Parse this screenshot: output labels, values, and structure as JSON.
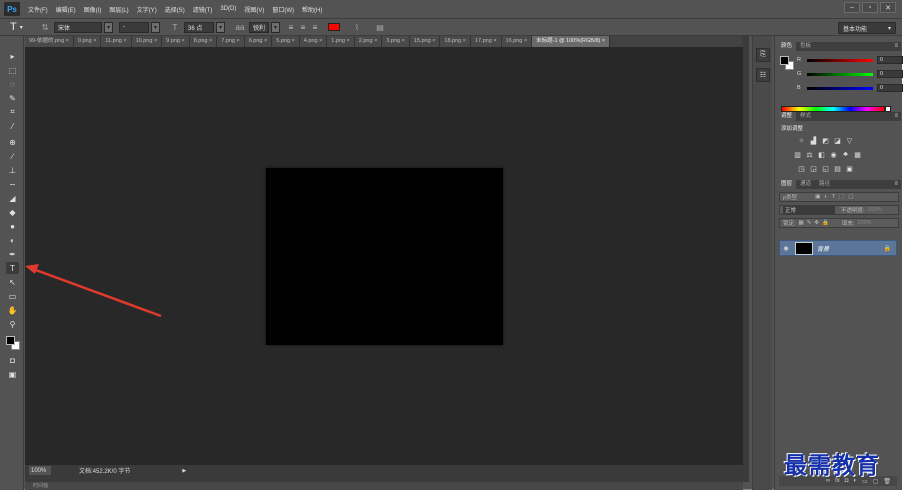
{
  "app": {
    "logo": "Ps"
  },
  "menu": [
    "文件(F)",
    "编辑(E)",
    "图像(I)",
    "图层(L)",
    "文字(Y)",
    "选择(S)",
    "滤镜(T)",
    "3D(D)",
    "视图(V)",
    "窗口(W)",
    "帮助(H)"
  ],
  "window_controls": {
    "minimize": "–",
    "restore": "▫",
    "close": "✕"
  },
  "options": {
    "tool_glyph": "T",
    "font_family": "宋体",
    "font_style": "-",
    "font_size": "36 点",
    "aa_label": "aa",
    "antialias": "锐利",
    "text_color": "#ff0000",
    "workspace": "基本功能"
  },
  "tabs": [
    {
      "label": "99-依据的.png"
    },
    {
      "label": "0.png"
    },
    {
      "label": "11.png"
    },
    {
      "label": "10.png"
    },
    {
      "label": "9.png"
    },
    {
      "label": "8.png"
    },
    {
      "label": "7.png"
    },
    {
      "label": "6.png"
    },
    {
      "label": "5.png"
    },
    {
      "label": "4.png"
    },
    {
      "label": "1.png"
    },
    {
      "label": "2.png"
    },
    {
      "label": "3.png"
    },
    {
      "label": "15.png"
    },
    {
      "label": "18.png"
    },
    {
      "label": "17.png"
    },
    {
      "label": "16.png"
    },
    {
      "label": "未标题-1 @ 100%(RGB/8)",
      "active": true
    }
  ],
  "status": {
    "zoom": "100%",
    "doc": "文档:452.2K/0 字节",
    "arrow": "▶"
  },
  "timeline": {
    "label": "时间轴"
  },
  "color_panel": {
    "tabs": [
      "颜色",
      "色板"
    ],
    "channels": [
      {
        "label": "R",
        "value": "0"
      },
      {
        "label": "G",
        "value": "0"
      },
      {
        "label": "B",
        "value": "0"
      }
    ]
  },
  "adjust_panel": {
    "tabs": [
      "调整",
      "样式"
    ],
    "title": "添加调整"
  },
  "layers_panel": {
    "tabs": [
      "图层",
      "通道",
      "路径"
    ],
    "filter": "ρ类型",
    "blend": "正常",
    "opacity_label": "不透明度:",
    "opacity_value": "100%",
    "lock_label": "锁定:",
    "fill_label": "填充:",
    "fill_value": "100%",
    "layer_name": "背景"
  },
  "watermark": "最需教育",
  "colors": {
    "canvas": "#000000",
    "workspace": "#282828",
    "ui": "#535353",
    "arrow": "#e03a2e"
  }
}
